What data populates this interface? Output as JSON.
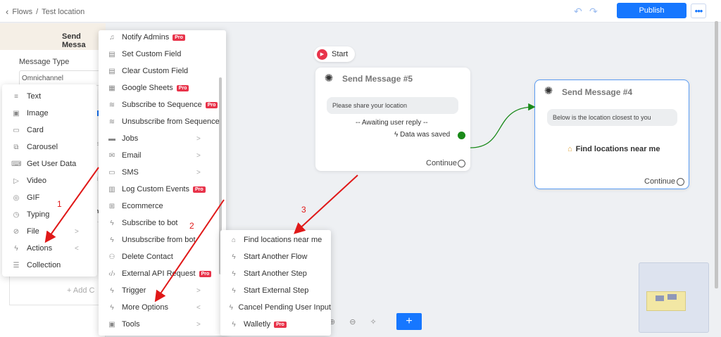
{
  "header": {
    "breadcrumb": {
      "root": "Flows",
      "separator": "/",
      "current": "Test location"
    },
    "publish_label": "Publish",
    "more_label": "•••"
  },
  "left_panel": {
    "header": "Send Messa",
    "message_type_label": "Message Type",
    "message_type_value": "Omnichannel",
    "add_label": "+ Add C",
    "partial_1": "s",
    "partial_2": "i",
    "partial_3": "h"
  },
  "add_menu": [
    {
      "label": "Text",
      "icon": "text-icon"
    },
    {
      "label": "Image",
      "icon": "image-icon"
    },
    {
      "label": "Card",
      "icon": "card-icon"
    },
    {
      "label": "Carousel",
      "icon": "carousel-icon"
    },
    {
      "label": "Get User Data",
      "icon": "keyboard-icon"
    },
    {
      "label": "Video",
      "icon": "video-icon"
    },
    {
      "label": "GIF",
      "icon": "gif-icon"
    },
    {
      "label": "Typing",
      "icon": "clock-icon"
    },
    {
      "label": "File",
      "icon": "paperclip-icon",
      "chevron": ">"
    },
    {
      "label": "Actions",
      "icon": "bolt-icon",
      "chevron": "<"
    },
    {
      "label": "Collection",
      "icon": "list-icon"
    }
  ],
  "actions_menu": [
    {
      "label": "Notify Admins",
      "icon": "bell-icon",
      "pro": "Pro"
    },
    {
      "label": "Set Custom Field",
      "icon": "database-icon"
    },
    {
      "label": "Clear Custom Field",
      "icon": "database-icon"
    },
    {
      "label": "Google Sheets",
      "icon": "sheet-icon",
      "pro": "Pro"
    },
    {
      "label": "Subscribe to Sequence",
      "icon": "layers-icon",
      "pro": "Pro"
    },
    {
      "label": "Unsubscribe from Sequence",
      "icon": "layers-icon"
    },
    {
      "label": "Jobs",
      "icon": "briefcase-icon",
      "chevron": ">"
    },
    {
      "label": "Email",
      "icon": "mail-icon",
      "chevron": ">"
    },
    {
      "label": "SMS",
      "icon": "chat-icon",
      "chevron": ">"
    },
    {
      "label": "Log Custom Events",
      "icon": "chart-icon",
      "pro": "Pro"
    },
    {
      "label": "Ecommerce",
      "icon": "cart-icon"
    },
    {
      "label": "Subscribe to bot",
      "icon": "bolt-icon"
    },
    {
      "label": "Unsubscribe from bot",
      "icon": "bolt-icon"
    },
    {
      "label": "Delete Contact",
      "icon": "user-delete-icon"
    },
    {
      "label": "External API Request",
      "icon": "code-icon",
      "pro": "Pro"
    },
    {
      "label": "Trigger",
      "icon": "bolt-icon",
      "chevron": ">"
    },
    {
      "label": "More Options",
      "icon": "bolt-icon",
      "chevron": "<"
    },
    {
      "label": "Tools",
      "icon": "toolbox-icon",
      "chevron": ">"
    }
  ],
  "more_options_menu": [
    {
      "label": "Find locations near me",
      "icon": "map-icon"
    },
    {
      "label": "Start Another Flow",
      "icon": "bolt-icon"
    },
    {
      "label": "Start Another Step",
      "icon": "bolt-icon"
    },
    {
      "label": "Start External Step",
      "icon": "bolt-icon"
    },
    {
      "label": "Cancel Pending User Input",
      "icon": "bolt-icon"
    },
    {
      "label": "Walletly",
      "icon": "bolt-icon",
      "pro": "Pro"
    }
  ],
  "canvas": {
    "start_label": "Start",
    "node5": {
      "title": "Send Message #5",
      "message": "Please share your location",
      "awaiting": "-- Awaiting user reply --",
      "saved": "Data was saved",
      "continue": "Continue"
    },
    "node4": {
      "title": "Send Message #4",
      "message": "Below is the location closest to you",
      "button": "Find locations near me",
      "continue": "Continue"
    }
  },
  "annotations": {
    "one": "1",
    "two": "2",
    "three": "3"
  },
  "colors": {
    "accent": "#1677ff",
    "pro": "#e8334a",
    "annotation": "#e01818",
    "connector": "#1a8a1a"
  }
}
